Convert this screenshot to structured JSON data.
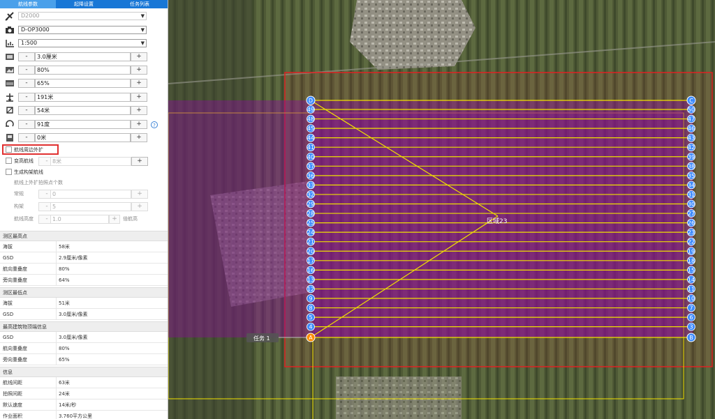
{
  "tabs": [
    {
      "label": "航线参数"
    },
    {
      "label": "起降设置"
    },
    {
      "label": "任务列表"
    }
  ],
  "selects": {
    "aircraft": "D2000",
    "camera": "D-OP3000",
    "scale": "1:500"
  },
  "params": {
    "gsd": "3.0厘米",
    "forward_overlap": "80%",
    "side_overlap": "65%",
    "altitude": "191米",
    "spacing": "54米",
    "heading": "91度",
    "extend": "0米",
    "minus": "-",
    "plus": "+"
  },
  "options": {
    "expand_label": "航线周边外扩",
    "variable_height_label": "变高航线",
    "variable_height_value": "8米",
    "generate_label": "生成构架航线",
    "outward_label": "航线上外扩拍照点个数",
    "normal_label": "常规",
    "normal_value": "0",
    "frame_label": "构架",
    "frame_value": "5",
    "height_label": "航线高度",
    "height_value": "1.0",
    "height_unit": "倍航高",
    "help": "?"
  },
  "info": {
    "highest": {
      "title": "测区最高点",
      "rows": [
        {
          "k": "海拔",
          "v": "58米"
        },
        {
          "k": "GSD",
          "v": "2.9厘米/像素"
        },
        {
          "k": "航向重叠度",
          "v": "80%"
        },
        {
          "k": "旁向重叠度",
          "v": "64%"
        }
      ]
    },
    "lowest": {
      "title": "测区最低点",
      "rows": [
        {
          "k": "海拔",
          "v": "51米"
        },
        {
          "k": "GSD",
          "v": "3.0厘米/像素"
        }
      ]
    },
    "building": {
      "title": "最高建筑物顶端信息",
      "rows": [
        {
          "k": "GSD",
          "v": "3.0厘米/像素"
        },
        {
          "k": "航向重叠度",
          "v": "80%"
        },
        {
          "k": "旁向重叠度",
          "v": "65%"
        }
      ]
    },
    "general": {
      "title": "信息",
      "rows": [
        {
          "k": "航线间距",
          "v": "63米"
        },
        {
          "k": "拍照间距",
          "v": "24米"
        },
        {
          "k": "默认速度",
          "v": "14米/秒"
        },
        {
          "k": "作业面积",
          "v": "3.760平方公里"
        }
      ]
    }
  },
  "map": {
    "area_label": "区域23",
    "task_label": "任务 1",
    "corners": {
      "a": "A",
      "b": "B",
      "c": "C",
      "d": "D"
    },
    "left_waypoints": [
      "49",
      "48",
      "45",
      "44",
      "41",
      "40",
      "37",
      "36",
      "33",
      "32",
      "29",
      "28",
      "25",
      "24",
      "21",
      "20",
      "17",
      "16",
      "13",
      "12",
      "9",
      "8",
      "5",
      "4"
    ],
    "right_waypoints": [
      "50",
      "47",
      "46",
      "43",
      "42",
      "39",
      "38",
      "35",
      "34",
      "31",
      "30",
      "27",
      "26",
      "23",
      "22",
      "19",
      "18",
      "15",
      "14",
      "11",
      "10",
      "7",
      "6",
      "3"
    ],
    "colors": {
      "route": "#f0e000",
      "boundary": "#e02020",
      "area": "#8a0a9a",
      "waypoint": "#3d8bff",
      "home": "#ff8c00"
    }
  }
}
